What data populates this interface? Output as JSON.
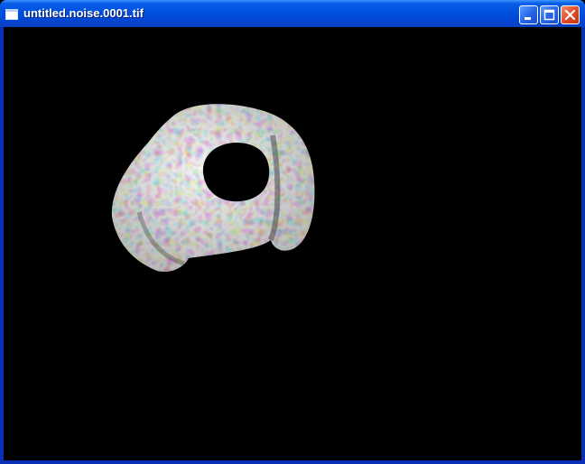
{
  "window": {
    "title": "untitled.noise.0001.tif",
    "icon": "window-icon",
    "buttons": {
      "minimize": "minimize-icon",
      "maximize": "maximize-icon",
      "close": "close-icon"
    }
  },
  "viewport": {
    "background_color": "#000000",
    "content": "rendered-noise-textured-3d-object"
  },
  "colors": {
    "titlebar_blue": "#0052e0",
    "close_red": "#de4a23",
    "frame_blue": "#0a2fb8"
  }
}
